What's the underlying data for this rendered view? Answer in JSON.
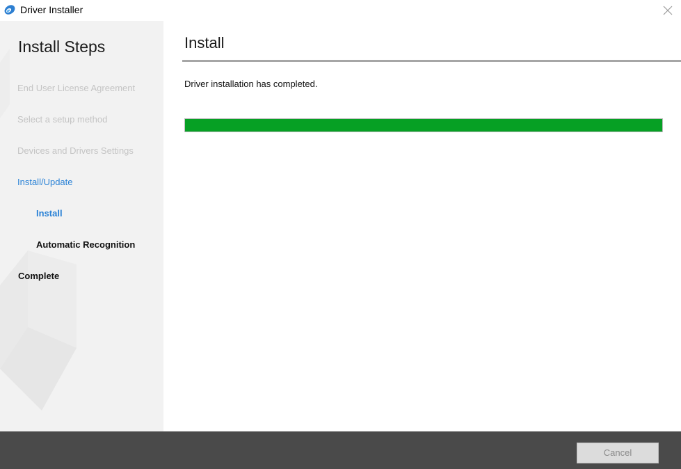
{
  "window": {
    "title": "Driver Installer",
    "app_icon": "driver-installer-icon",
    "close_icon": "close-icon"
  },
  "sidebar": {
    "heading": "Install Steps",
    "steps": [
      {
        "label": "End User License Agreement",
        "state": "done"
      },
      {
        "label": "Select a setup method",
        "state": "done"
      },
      {
        "label": "Devices and Drivers Settings",
        "state": "done"
      },
      {
        "label": "Install/Update",
        "state": "current"
      },
      {
        "label": "Install",
        "state": "current-sub"
      },
      {
        "label": "Automatic Recognition",
        "state": "pending-sub"
      },
      {
        "label": "Complete",
        "state": "pending"
      }
    ]
  },
  "main": {
    "heading": "Install",
    "status": "Driver installation has completed.",
    "progress_fraction": 1.0,
    "progress_color": "#06a024"
  },
  "footer": {
    "cancel_label": "Cancel"
  },
  "colors": {
    "accent": "#2a82d6",
    "sidebar_bg": "#f2f2f2",
    "footer_bg": "#4a4a4a",
    "done_text": "#c4c4c4"
  }
}
